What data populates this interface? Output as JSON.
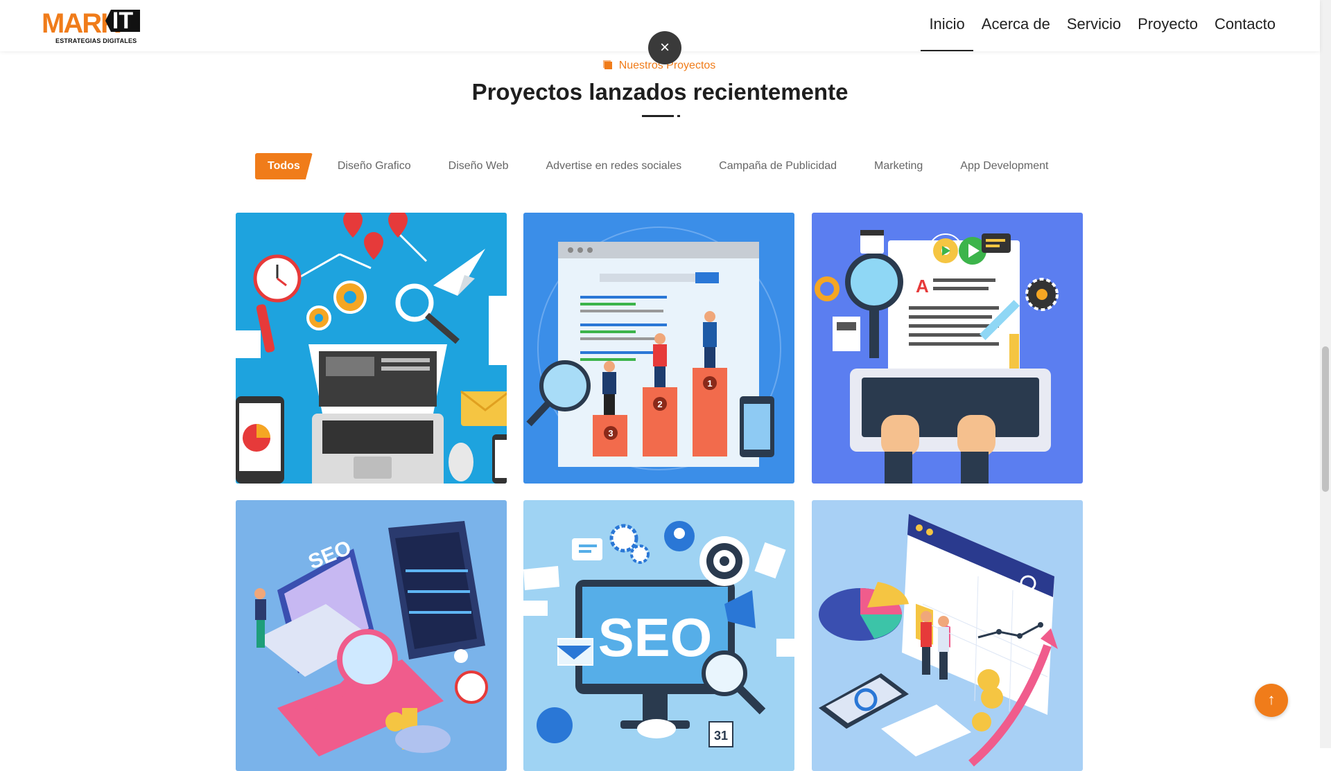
{
  "header": {
    "logo": {
      "word": "MARK",
      "it": "IT",
      "tagline": "ESTRATEGIAS DIGITALES"
    },
    "nav": [
      {
        "label": "Inicio",
        "active": true
      },
      {
        "label": "Acerca de"
      },
      {
        "label": "Servicio"
      },
      {
        "label": "Proyecto"
      },
      {
        "label": "Contacto"
      }
    ]
  },
  "close_icon": "×",
  "section": {
    "subtitle": "Nuestros Proyectos",
    "title": "Proyectos lanzados recientemente"
  },
  "filters": [
    {
      "label": "Todos",
      "active": true
    },
    {
      "label": "Diseño Grafico"
    },
    {
      "label": "Diseño Web"
    },
    {
      "label": "Advertise en redes sociales"
    },
    {
      "label": "Campaña de Publicidad"
    },
    {
      "label": "Marketing"
    },
    {
      "label": "App Development"
    }
  ],
  "projects": [
    {
      "illustration": "digital-marketing-laptop",
      "bg": "#1ea3de"
    },
    {
      "illustration": "seo-ranking-podium",
      "bg": "#3b8ee8"
    },
    {
      "illustration": "content-writing-keyboard",
      "bg": "#5b7ef0"
    },
    {
      "illustration": "seo-analytics-isometric",
      "bg": "#7ab3ea"
    },
    {
      "illustration": "seo-monitor",
      "bg": "#9fd3f3"
    },
    {
      "illustration": "data-dashboard-isometric",
      "bg": "#a8d0f5"
    }
  ],
  "seo_text": "SEO",
  "seo_small": "SEO",
  "calendar_day": "31",
  "podium": [
    "1",
    "2",
    "3"
  ],
  "scroll_top_icon": "↑",
  "colors": {
    "accent": "#f07c1a",
    "dark": "#222222"
  }
}
